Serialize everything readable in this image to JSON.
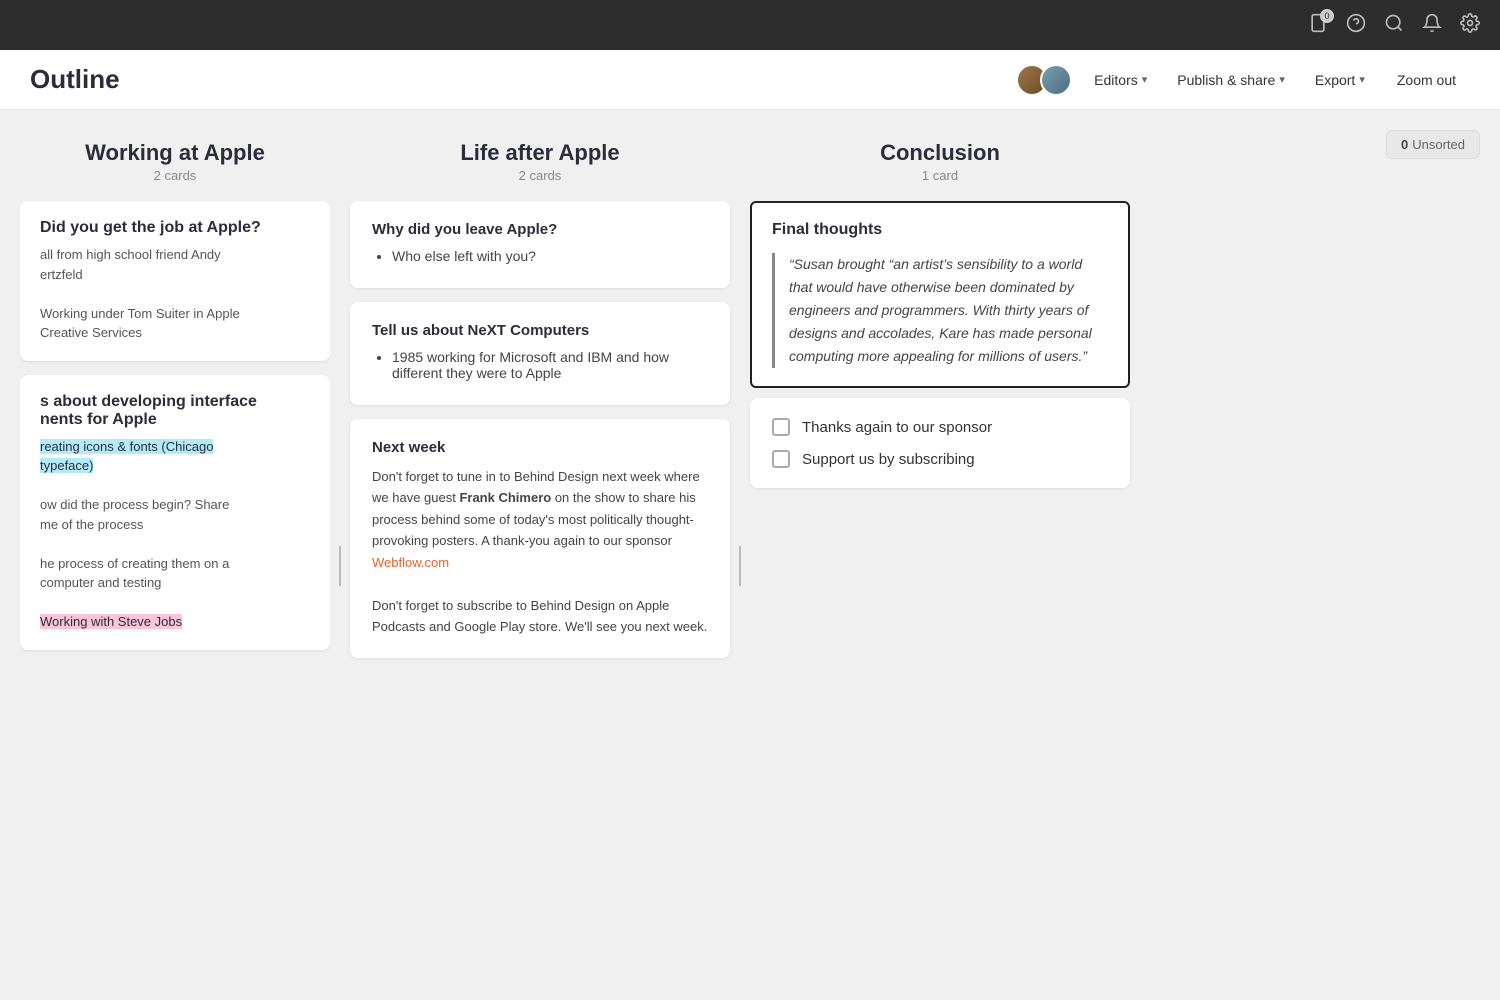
{
  "topbar": {
    "badge_count": "0",
    "icons": [
      "tablet-icon",
      "help-icon",
      "search-icon",
      "bell-icon",
      "settings-icon"
    ]
  },
  "header": {
    "title": "Outline",
    "editors_label": "Editors",
    "publish_label": "Publish & share",
    "export_label": "Export",
    "zoom_out_label": "Zoom out"
  },
  "unsorted": {
    "count": "0",
    "label": "Unsorted"
  },
  "column_left": {
    "title": "Working at Apple",
    "subtitle": "2 cards",
    "card1": {
      "title": "Did you get the job at Apple?",
      "body": "all from high school friend Andy\nertzfeld\n\nWorking under Tom Suiter in Apple\nCreative Services"
    },
    "card2": {
      "title": "s about developing interface\nnents for Apple",
      "items": [
        "Creating icons & fonts (Chicago\nTypeface)",
        "ow did the process begin? Share\nme of the process",
        "he process of creating them on a\ncomputer and testing",
        "Working with Steve Jobs"
      ]
    }
  },
  "column_middle": {
    "title": "Life after Apple",
    "subtitle": "2 cards",
    "card1": {
      "title": "Why did you leave Apple?",
      "items": [
        "Who else left with you?"
      ]
    },
    "card2": {
      "title": "Tell us about NeXT Computers",
      "items": [
        "1985 working for Microsoft and IBM and how different they were to Apple"
      ]
    },
    "card3": {
      "title": "Next week",
      "body_part1": "Don't forget to tune in to Behind Design next week where we have guest ",
      "bold_name": "Frank Chimero",
      "body_part2": " on the show to share his process behind some of today's most politically thought-provoking posters. A  thank-you again to our sponsor ",
      "link_text": "Webflow.com",
      "body_part3": "\n\nDon't forget to subscribe to Behind Design on Apple Podcasts and Google Play store. We'll see you next week."
    }
  },
  "column_right": {
    "title": "Conclusion",
    "subtitle": "1 card",
    "card1": {
      "title": "Final thoughts",
      "quote": "“Susan brought “an artist’s sensibility to a world that would have otherwise been dominated by engineers and programmers. With thirty years of designs and accolades, Kare has made personal computing more appealing for millions of users.”"
    },
    "checklist": {
      "item1": "Thanks again to our sponsor",
      "item2": "Support us by subscribing"
    }
  }
}
